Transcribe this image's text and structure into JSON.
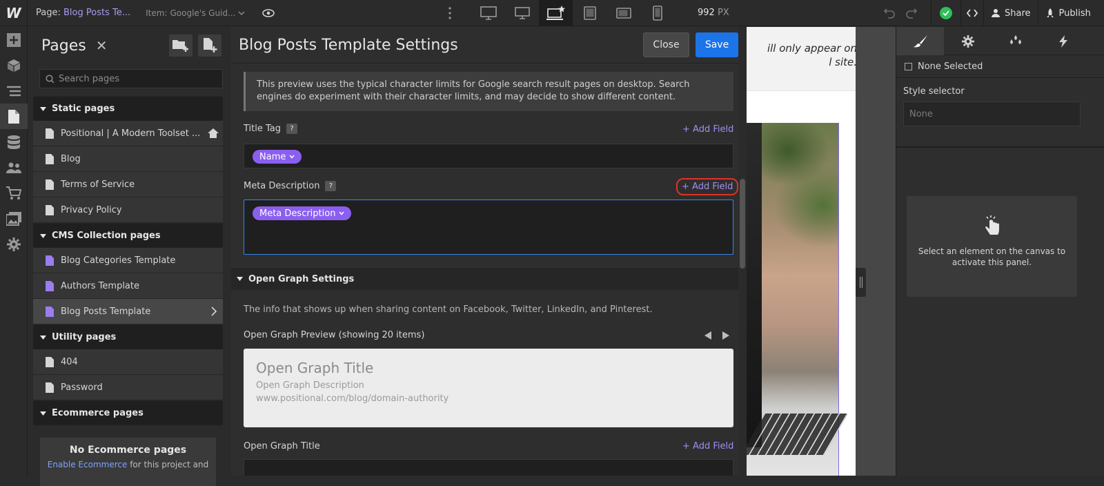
{
  "topbar": {
    "logo": "W",
    "page_prefix": "Page:",
    "page_name": "Blog Posts Te...",
    "item_prefix": "Item:",
    "item_name": "Google's Guid...",
    "width_value": "992",
    "width_unit": "PX",
    "share_label": "Share",
    "publish_label": "Publish",
    "status_color": "#2fbf5b"
  },
  "pages_panel": {
    "title": "Pages",
    "search_placeholder": "Search pages",
    "groups": [
      {
        "label": "Static pages",
        "items": [
          "Positional | A Modern Toolset ...",
          "Blog",
          "Terms of Service",
          "Privacy Policy"
        ]
      },
      {
        "label": "CMS Collection pages",
        "items": [
          "Blog Categories Template",
          "Authors Template",
          "Blog Posts Template"
        ]
      },
      {
        "label": "Utility pages",
        "items": [
          "404",
          "Password"
        ]
      },
      {
        "label": "Ecommerce pages",
        "items": []
      }
    ],
    "ecommerce_empty_title": "No Ecommerce pages",
    "ecommerce_link": "Enable Ecommerce",
    "ecommerce_text": "for this project and"
  },
  "settings": {
    "title": "Blog Posts Template Settings",
    "close_label": "Close",
    "save_label": "Save",
    "info_text": "This preview uses the typical character limits for Google search result pages on desktop. Search engines do experiment with their character limits, and may decide to show different content.",
    "title_tag_label": "Title Tag",
    "title_tag_chip": "Name",
    "meta_desc_label": "Meta Description",
    "meta_desc_chip": "Meta Description",
    "add_field_label": "+ Add Field",
    "help_label": "?",
    "og_section": "Open Graph Settings",
    "og_info": "The info that shows up when sharing content on Facebook, Twitter, LinkedIn, and Pinterest.",
    "og_preview_label": "Open Graph Preview (showing 20 items)",
    "og_preview_title": "Open Graph Title",
    "og_preview_desc": "Open Graph Description",
    "og_preview_url": "www.positional.com/blog/domain-authority",
    "og_title_label": "Open Graph Title"
  },
  "canvas": {
    "text_line1": "ill only appear on",
    "text_line2": "l site."
  },
  "right_panel": {
    "none_selected": "None Selected",
    "style_selector_label": "Style selector",
    "style_selector_placeholder": "None",
    "empty_message": "Select an element on the canvas to activate this panel."
  }
}
